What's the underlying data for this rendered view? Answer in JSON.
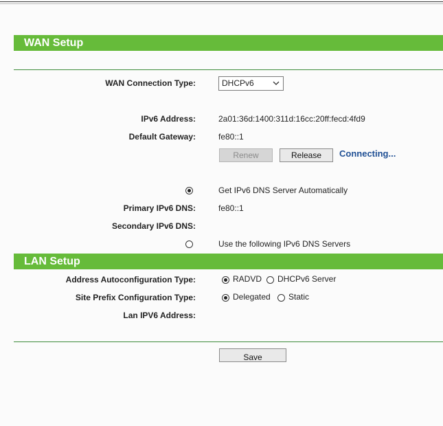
{
  "wan": {
    "title": "WAN Setup",
    "connection_type_label": "WAN Connection Type:",
    "connection_type_value": "DHCPv6",
    "ipv6_address_label": "IPv6 Address:",
    "ipv6_address_value": "2a01:36d:1400:311d:16cc:20ff:fecd:4fd9",
    "gateway_label": "Default Gateway:",
    "gateway_value": "fe80::1",
    "renew_label": "Renew",
    "release_label": "Release",
    "status": "Connecting...",
    "dns_auto_label": "Get IPv6 DNS Server Automatically",
    "primary_dns_label": "Primary IPv6 DNS:",
    "primary_dns_value": "fe80::1",
    "secondary_dns_label": "Secondary IPv6 DNS:",
    "dns_manual_label": "Use the following IPv6 DNS Servers"
  },
  "lan": {
    "title": "LAN Setup",
    "autoconfig_label": "Address Autoconfiguration Type:",
    "autoconfig_radvd": "RADVD",
    "autoconfig_dhcpv6": "DHCPv6 Server",
    "prefix_label": "Site Prefix Configuration Type:",
    "prefix_delegated": "Delegated",
    "prefix_static": "Static",
    "lan_ipv6_label": "Lan IPV6 Address:"
  },
  "save_label": "Save",
  "colors": {
    "section_bar": "#66bb3a",
    "status_text": "#1f4f94",
    "divider": "#3d8b3a"
  }
}
